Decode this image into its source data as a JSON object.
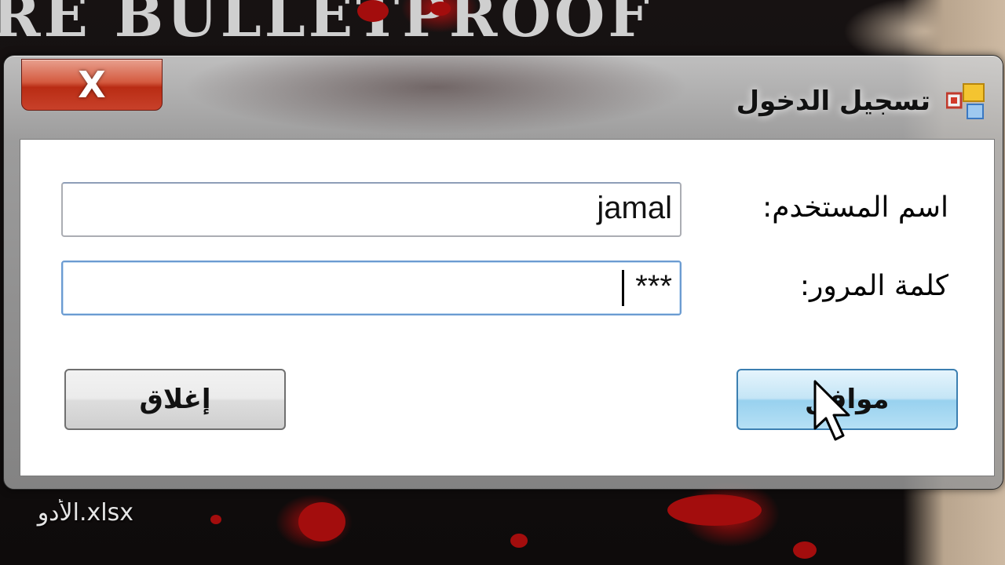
{
  "desktop": {
    "banner_text": "RE BULLETPROOF",
    "file_label": "الأدو.xlsx"
  },
  "window": {
    "title": "تسجيل الدخول",
    "close_glyph": "X",
    "app_icon": "windows-form-icon"
  },
  "form": {
    "username_label": "اسم المستخدم:",
    "username_value": "jamal",
    "password_label": "كلمة المرور:",
    "password_value": "***"
  },
  "buttons": {
    "ok_label": "موافق",
    "close_label": "إغلاق"
  },
  "colors": {
    "close_button": "#c8412a",
    "ok_button_border": "#3c7fb1",
    "input_focus_border": "#6b9bd1"
  }
}
